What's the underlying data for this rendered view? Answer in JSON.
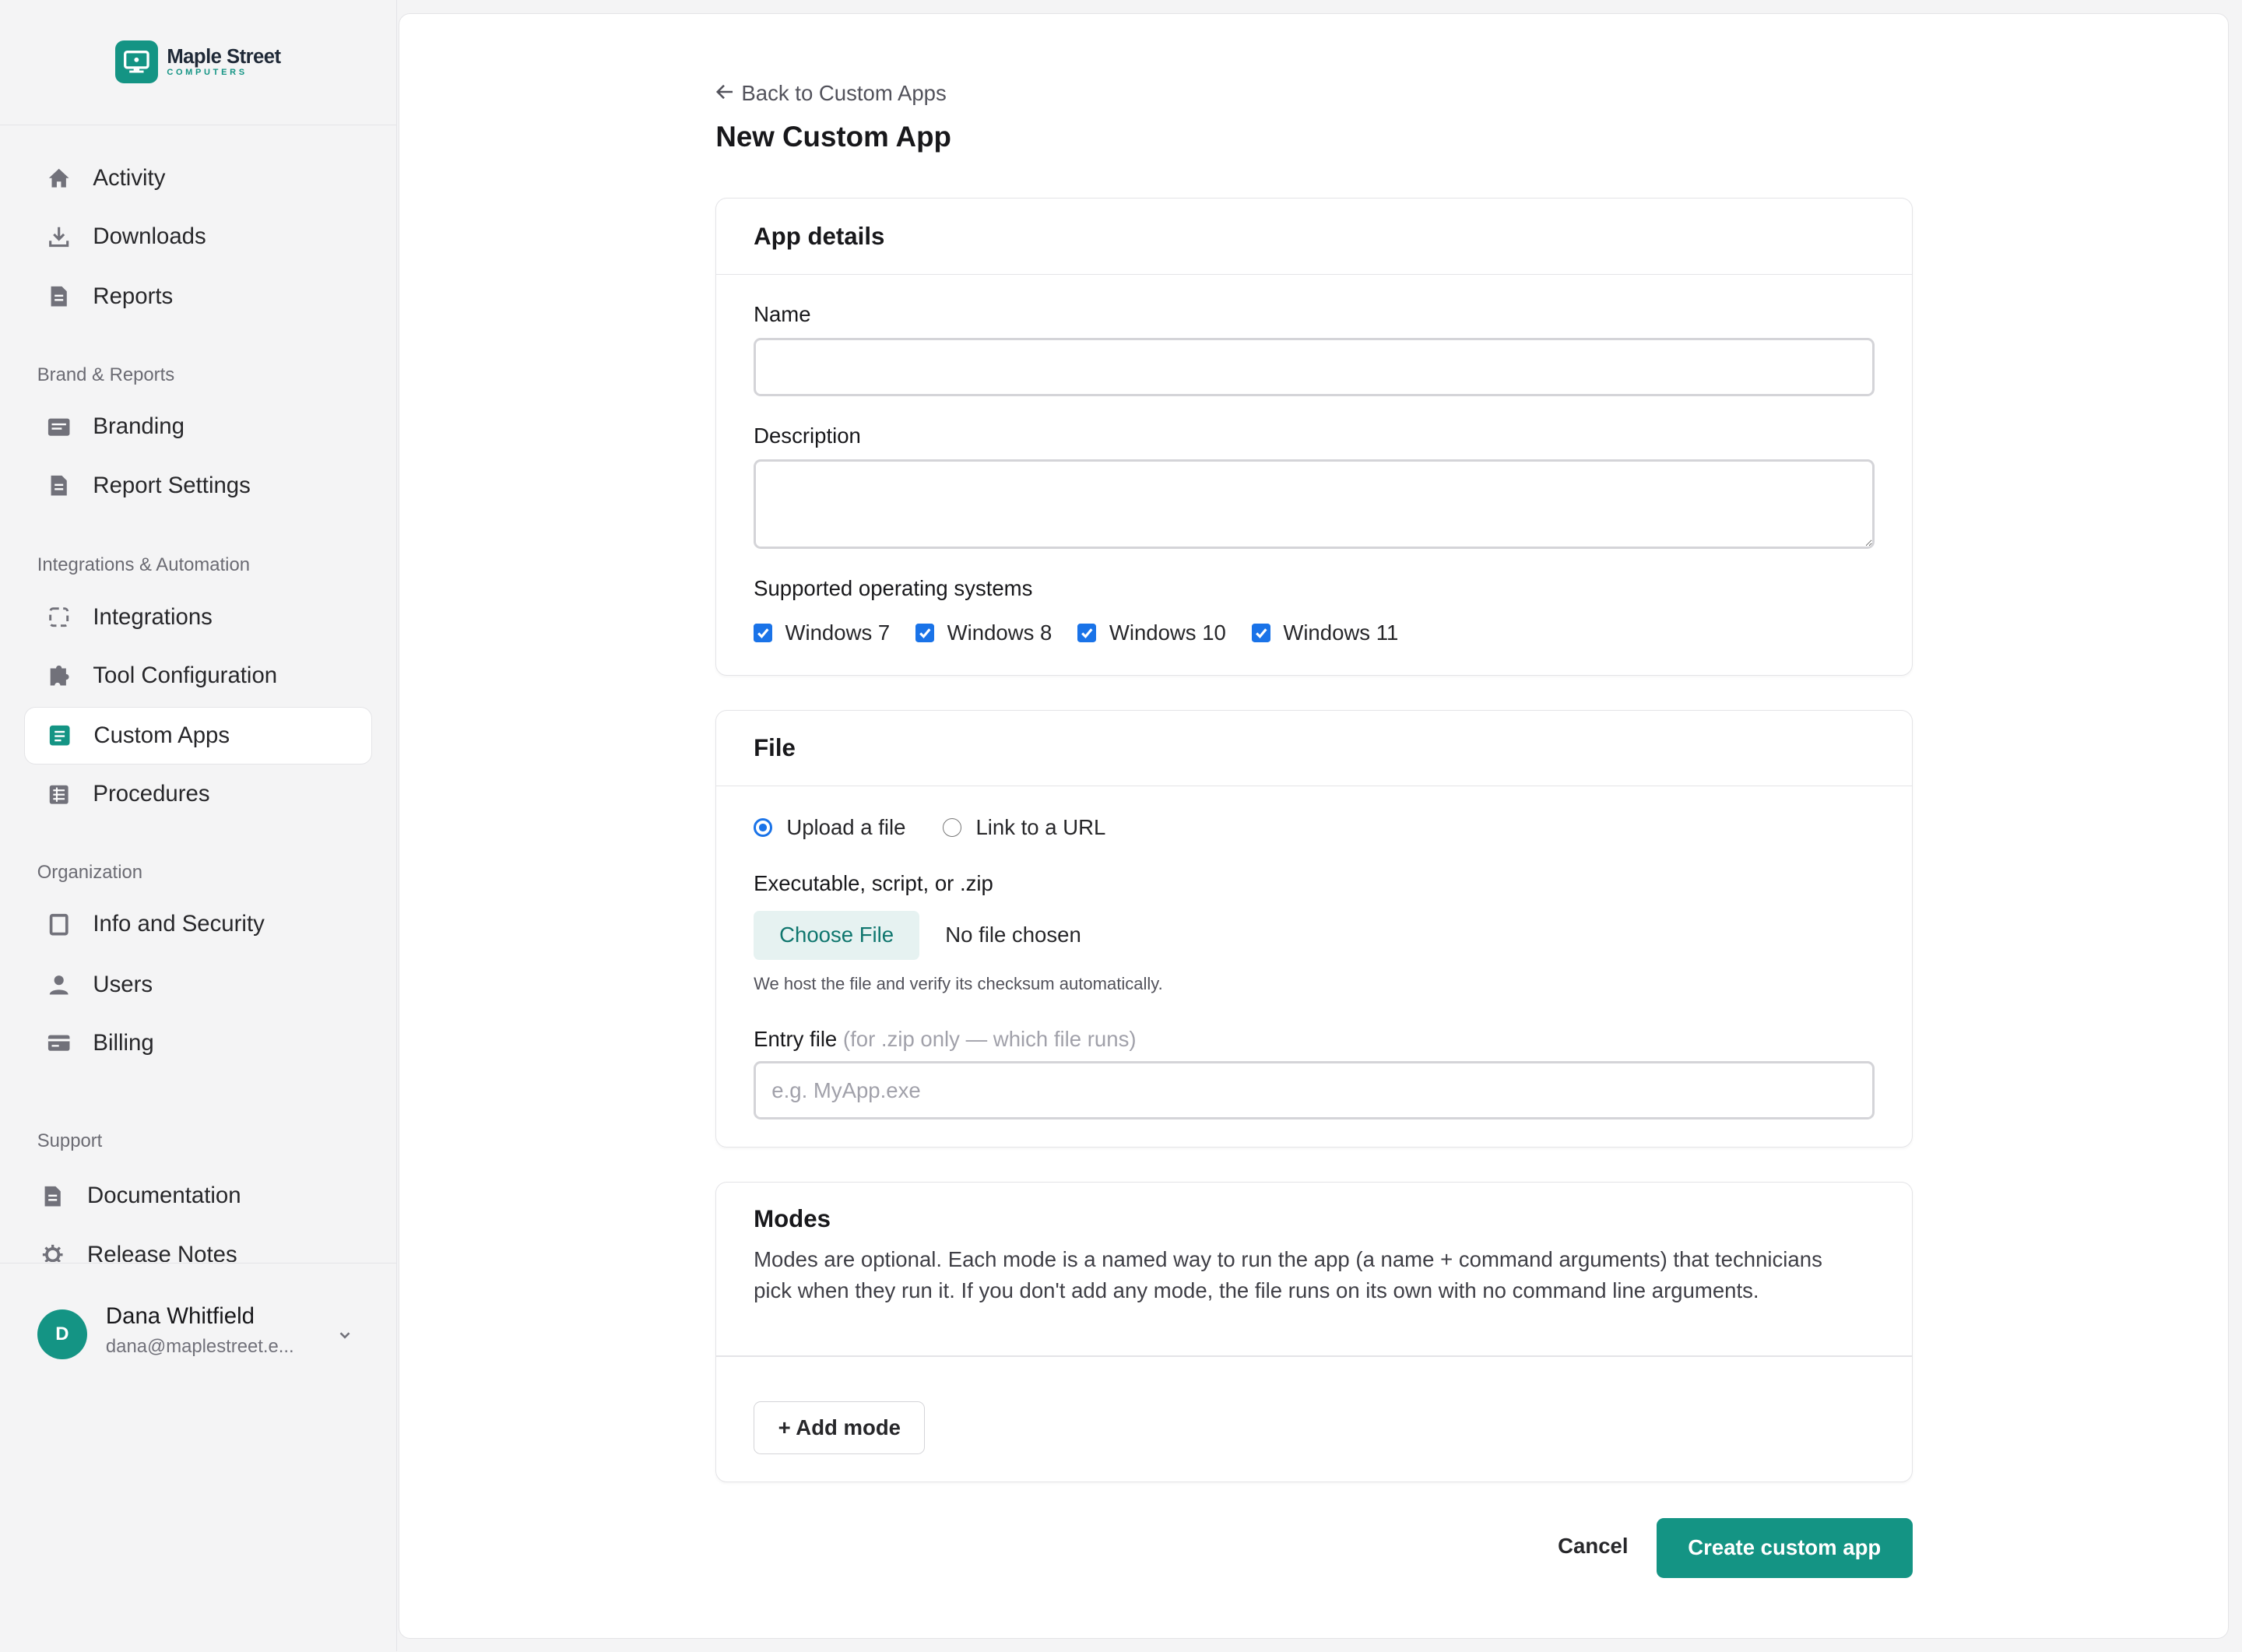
{
  "brand": {
    "name": "Maple Street",
    "tagline": "COMPUTERS",
    "accent": "#149484"
  },
  "sidebar": {
    "items": [
      {
        "label": "Activity",
        "icon": "home-icon"
      },
      {
        "label": "Downloads",
        "icon": "download-icon"
      },
      {
        "label": "Reports",
        "icon": "document-icon"
      },
      {
        "label": "Branding",
        "icon": "card-icon"
      },
      {
        "label": "Report Settings",
        "icon": "document-icon"
      },
      {
        "label": "Integrations",
        "icon": "dashed-square-icon"
      },
      {
        "label": "Tool Configuration",
        "icon": "puzzle-icon"
      },
      {
        "label": "Custom Apps",
        "icon": "app-icon",
        "active": true
      },
      {
        "label": "Procedures",
        "icon": "list-icon"
      },
      {
        "label": "Info and Security",
        "icon": "square-icon"
      },
      {
        "label": "Users",
        "icon": "user-icon"
      },
      {
        "label": "Billing",
        "icon": "credit-card-icon"
      },
      {
        "label": "Documentation",
        "icon": "document-icon"
      },
      {
        "label": "Release Notes",
        "icon": "gear-icon"
      }
    ],
    "sections": {
      "brand_reports": "Brand & Reports",
      "integrations": "Integrations & Automation",
      "organization": "Organization",
      "support": "Support"
    },
    "user": {
      "initial": "D",
      "name": "Dana Whitfield",
      "email": "dana@maplestreet.e..."
    }
  },
  "main": {
    "back_label": "Back to Custom Apps",
    "title": "New Custom App",
    "details": {
      "heading": "App details",
      "name_label": "Name",
      "name_value": "",
      "description_label": "Description",
      "description_value": "",
      "os_label": "Supported operating systems",
      "os_options": [
        {
          "label": "Windows 7",
          "checked": true
        },
        {
          "label": "Windows 8",
          "checked": true
        },
        {
          "label": "Windows 10",
          "checked": true
        },
        {
          "label": "Windows 11",
          "checked": true
        }
      ]
    },
    "file": {
      "heading": "File",
      "source_options": [
        {
          "label": "Upload a file",
          "selected": true
        },
        {
          "label": "Link to a URL",
          "selected": false
        }
      ],
      "upload_label": "Executable, script, or .zip",
      "choose_button": "Choose File",
      "file_status": "No file chosen",
      "hint": "We host the file and verify its checksum automatically.",
      "entry_label": "Entry file",
      "entry_note": "(for .zip only — which file runs)",
      "entry_placeholder": "e.g. MyApp.exe"
    },
    "modes": {
      "heading": "Modes",
      "description": "Modes are optional. Each mode is a named way to run the app (a name + command arguments) that technicians pick when they run it. If you don't add any mode, the file runs on its own with no command line arguments.",
      "add_button": "+ Add mode"
    },
    "actions": {
      "cancel": "Cancel",
      "create": "Create custom app"
    }
  }
}
